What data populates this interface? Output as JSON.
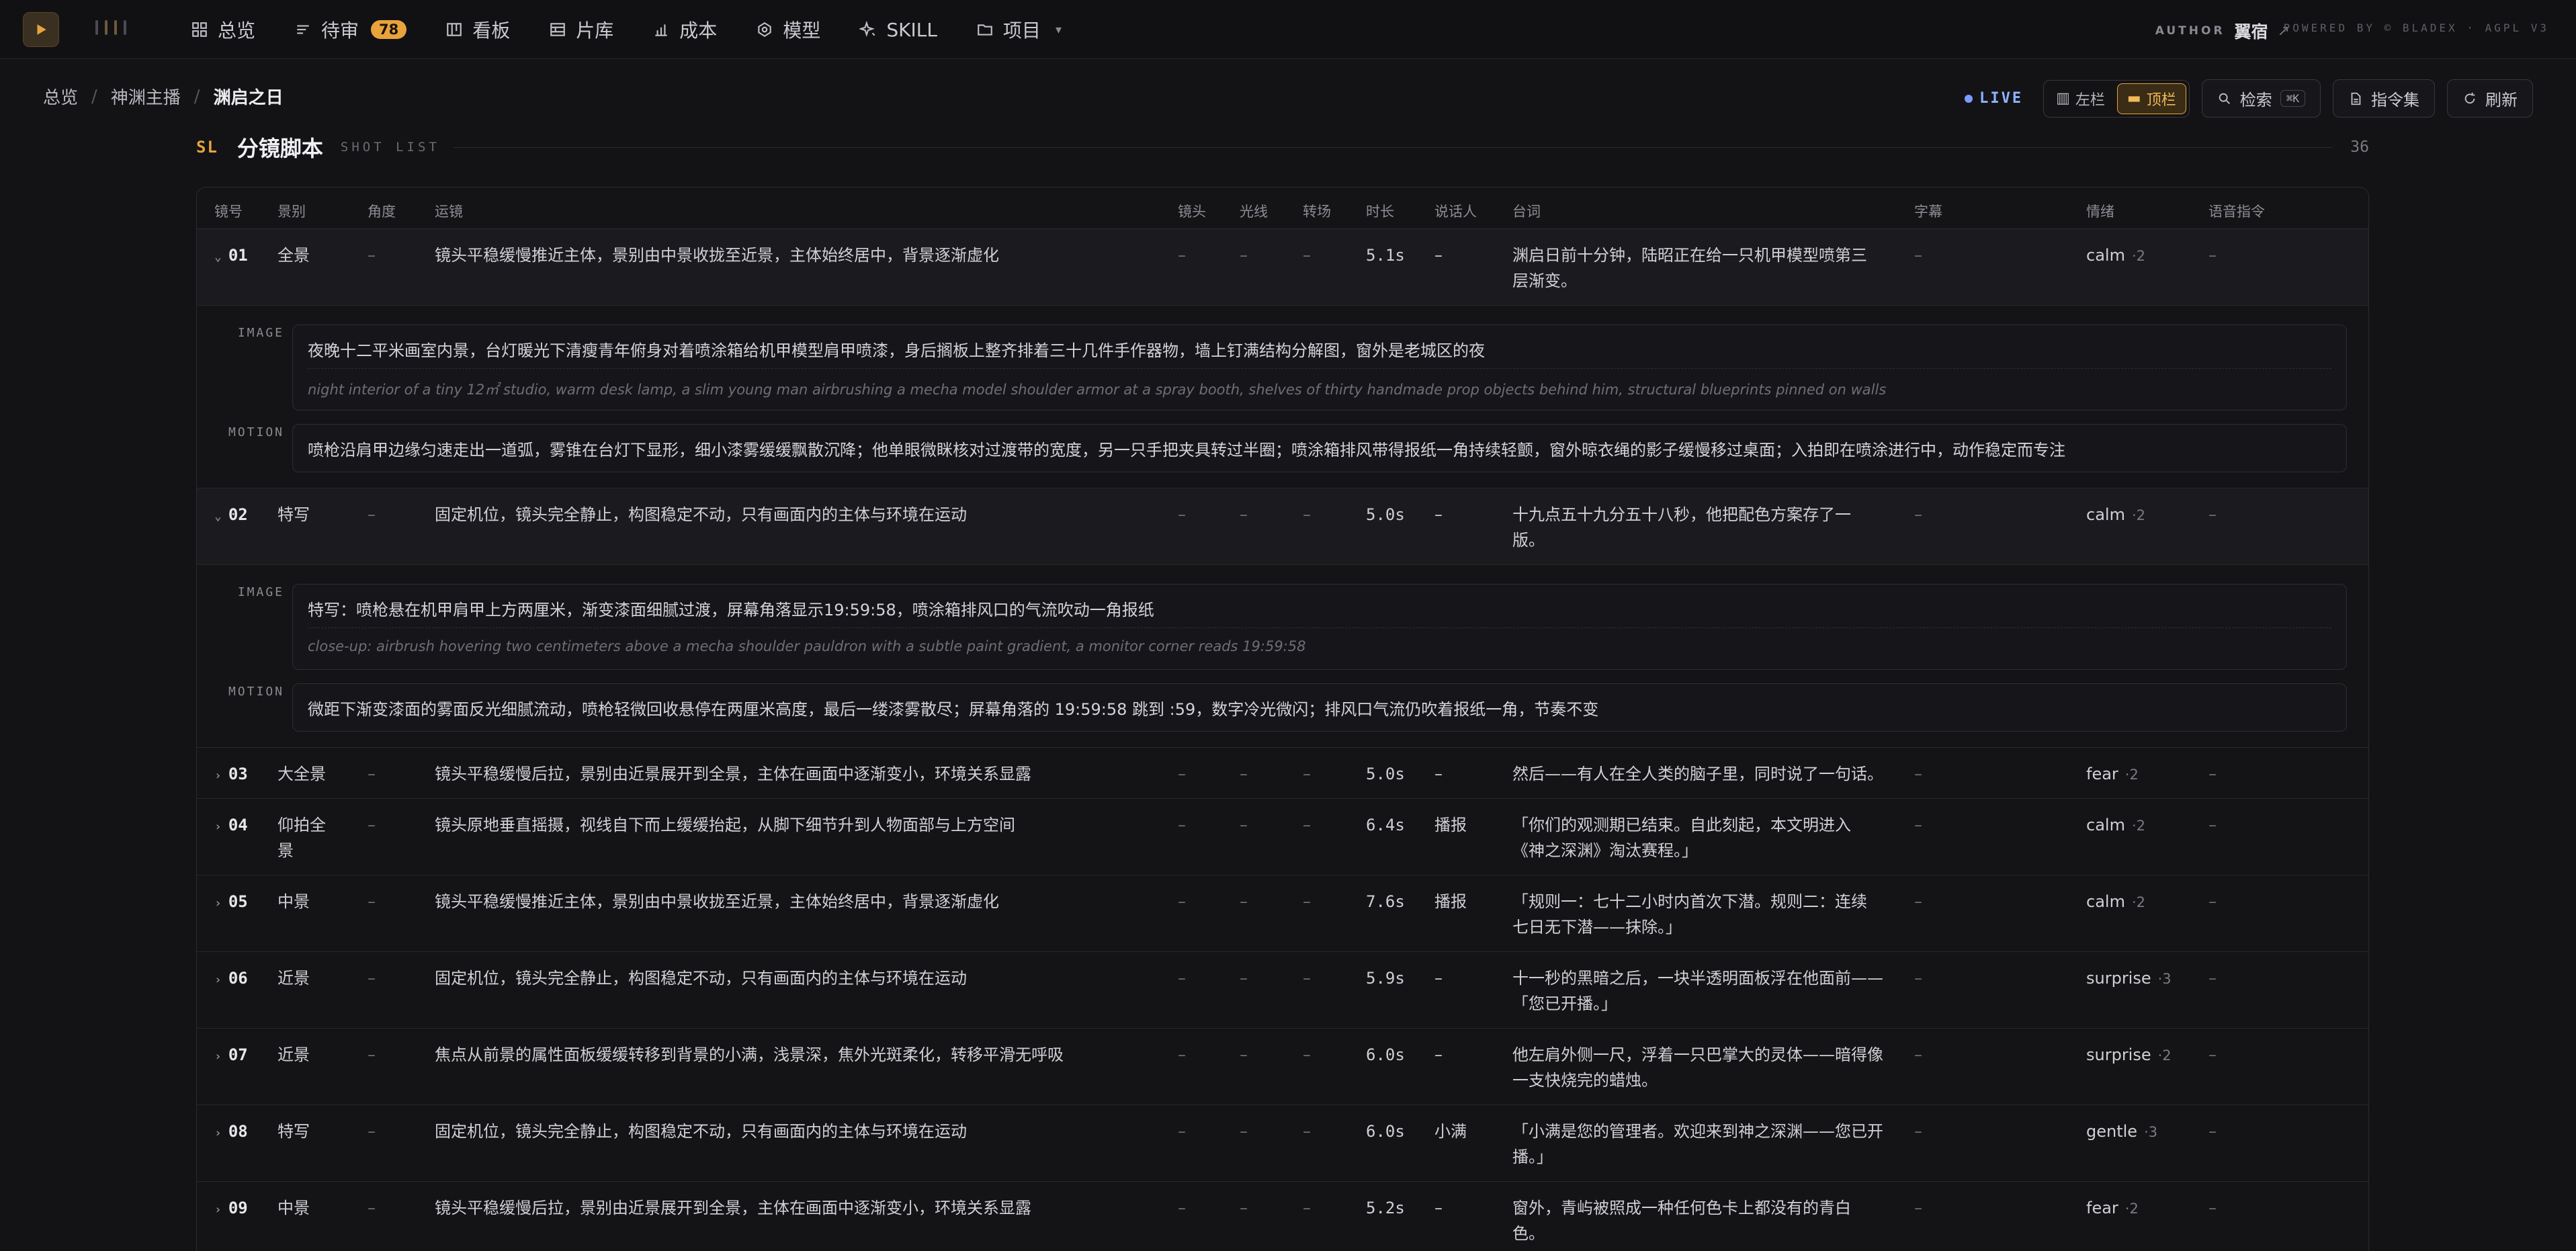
{
  "nav": {
    "items": [
      {
        "label": "总览",
        "icon": "grid-icon"
      },
      {
        "label": "待审",
        "icon": "list-icon",
        "badge": "78"
      },
      {
        "label": "看板",
        "icon": "board-icon"
      },
      {
        "label": "片库",
        "icon": "film-icon"
      },
      {
        "label": "成本",
        "icon": "chart-icon"
      },
      {
        "label": "模型",
        "icon": "model-icon"
      },
      {
        "label": "SKILL",
        "icon": "sparkle-icon"
      },
      {
        "label": "项目",
        "icon": "folder-icon"
      }
    ],
    "author_label": "AUTHOR",
    "author_name": "翼宿",
    "author_arrow": "↗",
    "powered": "POWERED BY © BLADEX · AGPL V3"
  },
  "breadcrumb": [
    "总览",
    "神渊主播",
    "渊启之日"
  ],
  "toolbar": {
    "live": "LIVE",
    "left_label": "左栏",
    "top_label": "顶栏",
    "search_label": "检索",
    "search_kbd": "⌘K",
    "commands_label": "指令集",
    "refresh_label": "刷新"
  },
  "section": {
    "code": "SL",
    "title": "分镜脚本",
    "subtitle": "SHOT LIST",
    "count": "36"
  },
  "columns": [
    "镜号",
    "景别",
    "角度",
    "运镜",
    "镜头",
    "光线",
    "转场",
    "时长",
    "说话人",
    "台词",
    "字幕",
    "情绪",
    "语音指令"
  ],
  "labels": {
    "image": "IMAGE",
    "motion": "MOTION",
    "dash": "–"
  },
  "rows": [
    {
      "id": "01",
      "expanded": true,
      "shot": "全景",
      "move": "镜头平稳缓慢推近主体，景别由中景收拢至近景，主体始终居中，背景逐渐虚化",
      "dur": "5.1s",
      "speaker": "–",
      "line1": "渊启日前十分钟，陆昭正在给一只机甲模型喷第三",
      "line2": "层渐变。",
      "emotion": "calm",
      "en": "·2",
      "image_zh": "夜晚十二平米画室内景，台灯暖光下清瘦青年俯身对着喷涂箱给机甲模型肩甲喷漆，身后搁板上整齐排着三十几件手作器物，墙上钉满结构分解图，窗外是老城区的夜",
      "image_en": "night interior of a tiny 12㎡ studio, warm desk lamp, a slim young man airbrushing a mecha model shoulder armor at a spray booth, shelves of thirty handmade prop objects behind him, structural blueprints pinned on walls",
      "motion": "喷枪沿肩甲边缘匀速走出一道弧，雾锥在台灯下显形，细小漆雾缓缓飘散沉降；他单眼微眯核对过渡带的宽度，另一只手把夹具转过半圈；喷涂箱排风带得报纸一角持续轻颤，窗外晾衣绳的影子缓慢移过桌面；入拍即在喷涂进行中，动作稳定而专注"
    },
    {
      "id": "02",
      "expanded": true,
      "shot": "特写",
      "move": "固定机位，镜头完全静止，构图稳定不动，只有画面内的主体与环境在运动",
      "dur": "5.0s",
      "speaker": "–",
      "line1": "十九点五十九分五十八秒，他把配色方案存了一",
      "line2": "版。",
      "emotion": "calm",
      "en": "·2",
      "image_zh": "特写：喷枪悬在机甲肩甲上方两厘米，渐变漆面细腻过渡，屏幕角落显示19:59:58，喷涂箱排风口的气流吹动一角报纸",
      "image_en": "close-up: airbrush hovering two centimeters above a mecha shoulder pauldron with a subtle paint gradient, a monitor corner reads 19:59:58",
      "motion": "微距下渐变漆面的雾面反光细腻流动，喷枪轻微回收悬停在两厘米高度，最后一缕漆雾散尽；屏幕角落的 19:59:58 跳到 :59，数字冷光微闪；排风口气流仍吹着报纸一角，节奏不变"
    },
    {
      "id": "03",
      "shot": "大全景",
      "move": "镜头平稳缓慢后拉，景别由近景展开到全景，主体在画面中逐渐变小，环境关系显露",
      "dur": "5.0s",
      "speaker": "–",
      "line1": "然后——有人在全人类的脑子里，同时说了一句话。",
      "line2": "",
      "emotion": "fear",
      "en": "·2"
    },
    {
      "id": "04",
      "shot": "仰拍全",
      "shot2": "景",
      "move": "镜头原地垂直摇摄，视线自下而上缓缓抬起，从脚下细节升到人物面部与上方空间",
      "dur": "6.4s",
      "speaker": "播报",
      "line1": "「你们的观测期已结束。自此刻起，本文明进入",
      "line2": "《神之深渊》淘汰赛程。」",
      "emotion": "calm",
      "en": "·2"
    },
    {
      "id": "05",
      "shot": "中景",
      "move": "镜头平稳缓慢推近主体，景别由中景收拢至近景，主体始终居中，背景逐渐虚化",
      "dur": "7.6s",
      "speaker": "播报",
      "line1": "「规则一：七十二小时内首次下潜。规则二：连续",
      "line2": "七日无下潜——抹除。」",
      "emotion": "calm",
      "en": "·2"
    },
    {
      "id": "06",
      "shot": "近景",
      "move": "固定机位，镜头完全静止，构图稳定不动，只有画面内的主体与环境在运动",
      "dur": "5.9s",
      "speaker": "–",
      "line1": "十一秒的黑暗之后，一块半透明面板浮在他面前——",
      "line2": "「您已开播。」",
      "emotion": "surprise",
      "en": "·3"
    },
    {
      "id": "07",
      "shot": "近景",
      "move": "焦点从前景的属性面板缓缓转移到背景的小满，浅景深，焦外光斑柔化，转移平滑无呼吸",
      "dur": "6.0s",
      "speaker": "–",
      "line1": "他左肩外侧一尺，浮着一只巴掌大的灵体——暗得像",
      "line2": "一支快烧完的蜡烛。",
      "emotion": "surprise",
      "en": "·2"
    },
    {
      "id": "08",
      "shot": "特写",
      "move": "固定机位，镜头完全静止，构图稳定不动，只有画面内的主体与环境在运动",
      "dur": "6.0s",
      "speaker": "小满",
      "line1": "「小满是您的管理者。欢迎来到神之深渊——您已开",
      "line2": "播。」",
      "emotion": "gentle",
      "en": "·3"
    },
    {
      "id": "09",
      "shot": "中景",
      "move": "镜头平稳缓慢后拉，景别由近景展开到全景，主体在画面中逐渐变小，环境关系显露",
      "dur": "5.2s",
      "speaker": "–",
      "line1": "窗外，青屿被照成一种任何色卡上都没有的青白",
      "line2": "色。",
      "emotion": "fear",
      "en": "·2"
    }
  ]
}
